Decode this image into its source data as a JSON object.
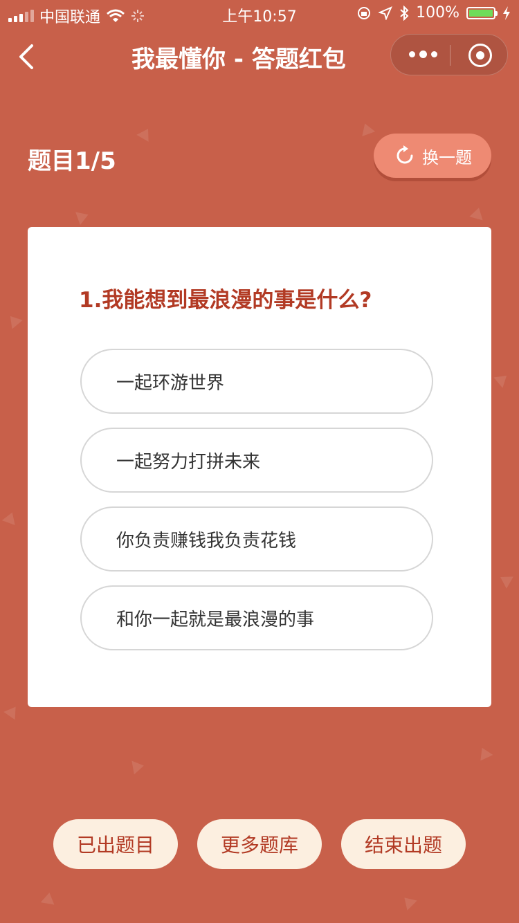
{
  "status_bar": {
    "carrier": "中国联通",
    "time": "上午10:57",
    "battery": "100%"
  },
  "nav": {
    "title": "我最懂你 - 答题红包"
  },
  "quiz": {
    "counter": "题目1/5",
    "switch_label": "换一题",
    "question": "1.我能想到最浪漫的事是什么?",
    "options": [
      "一起环游世界",
      "一起努力打拼未来",
      "你负责赚钱我负责花钱",
      "和你一起就是最浪漫的事"
    ]
  },
  "bottom": {
    "asked": "已出题目",
    "more_bank": "更多题库",
    "finish": "结束出题"
  },
  "colors": {
    "background": "#c8604a",
    "accent_text": "#b23a24",
    "switch_button": "#ee8a73",
    "pill_bg": "#fcefe0",
    "battery_fill": "#6fdc5a"
  }
}
